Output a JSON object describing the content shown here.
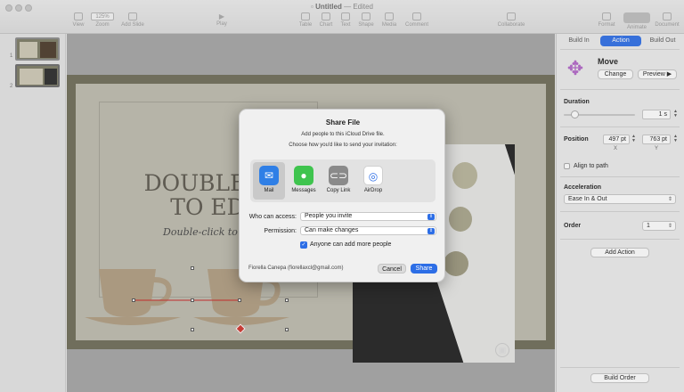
{
  "window": {
    "title": "Untitled",
    "status": "— Edited"
  },
  "toolbar": {
    "items": [
      {
        "label": "View",
        "icon": "view-icon"
      },
      {
        "label": "Zoom",
        "icon": "zoom-select",
        "value": "125%"
      },
      {
        "label": "Add Slide",
        "icon": "add-slide-icon"
      },
      {
        "label": "Play",
        "icon": "play-icon"
      },
      {
        "label": "Table",
        "icon": "table-icon"
      },
      {
        "label": "Chart",
        "icon": "chart-icon"
      },
      {
        "label": "Text",
        "icon": "text-icon"
      },
      {
        "label": "Shape",
        "icon": "shape-icon"
      },
      {
        "label": "Media",
        "icon": "media-icon"
      },
      {
        "label": "Comment",
        "icon": "comment-icon"
      },
      {
        "label": "Collaborate",
        "icon": "collaborate-icon"
      },
      {
        "label": "Format",
        "icon": "format-icon"
      },
      {
        "label": "Animate",
        "icon": "animate-icon"
      },
      {
        "label": "Document",
        "icon": "document-icon"
      }
    ]
  },
  "navigator": {
    "slides": [
      {
        "number": "1"
      },
      {
        "number": "2"
      }
    ]
  },
  "slide": {
    "title": "DOUBLE-C\nTO ED",
    "subtitle": "Double-click to e"
  },
  "inspector": {
    "tabs": [
      "Build In",
      "Action",
      "Build Out"
    ],
    "active_tab": "Action",
    "effect_name": "Move",
    "change_label": "Change",
    "preview_label": "Preview ▶",
    "duration_label": "Duration",
    "duration_value": "1 s",
    "duration_fraction": 0.15,
    "position_label": "Position",
    "position_x": "497 pt",
    "position_y": "763 pt",
    "x_label": "X",
    "y_label": "Y",
    "align_to_path_label": "Align to path",
    "acceleration_label": "Acceleration",
    "acceleration_value": "Ease In & Out",
    "order_label": "Order",
    "order_value": "1",
    "add_action_label": "Add Action",
    "build_order_label": "Build Order"
  },
  "share_dialog": {
    "title": "Share File",
    "line1": "Add people to this iCloud Drive file.",
    "line2": "Choose how you'd like to send your invitation:",
    "methods": [
      {
        "label": "Mail",
        "icon": "mail-icon"
      },
      {
        "label": "Messages",
        "icon": "messages-icon"
      },
      {
        "label": "Copy Link",
        "icon": "copy-link-icon"
      },
      {
        "label": "AirDrop",
        "icon": "airdrop-icon"
      }
    ],
    "selected_method": "Mail",
    "access_label": "Who can access:",
    "access_value": "People you invite",
    "permission_label": "Permission:",
    "permission_value": "Can make changes",
    "add_people_label": "Anyone can add more people",
    "add_people_checked": true,
    "account": "Fiorella Canepa (fiorellaxcl@gmail.com)",
    "cancel_label": "Cancel",
    "share_label": "Share"
  },
  "colors": {
    "accent": "#2d6ee6",
    "slide_frame": "#6e6c57",
    "paper": "#bdbbad",
    "cup": "#b09c80"
  }
}
